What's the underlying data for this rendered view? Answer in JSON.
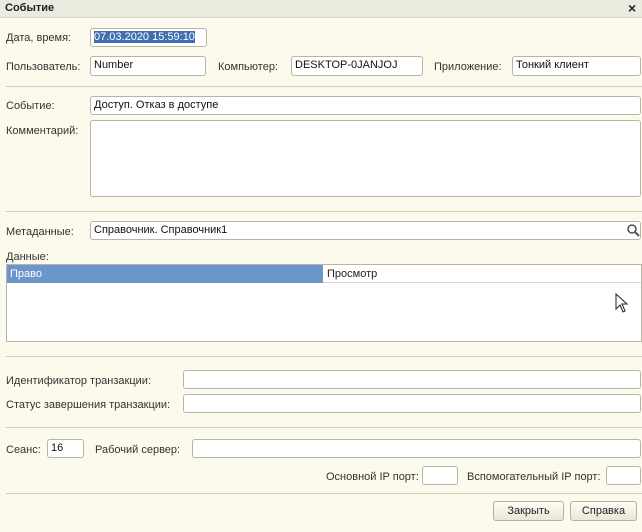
{
  "window": {
    "title": "Событие",
    "close_symbol": "×"
  },
  "fields": {
    "datetime": {
      "label": "Дата, время:",
      "value": "07.03.2020 15:59:10"
    },
    "user": {
      "label": "Пользователь:",
      "value": "Number"
    },
    "computer": {
      "label": "Компьютер:",
      "value": "DESKTOP-0JANJOJ"
    },
    "application": {
      "label": "Приложение:",
      "value": "Тонкий клиент"
    },
    "event": {
      "label": "Событие:",
      "value": "Доступ. Отказ в доступе"
    },
    "comment": {
      "label": "Комментарий:",
      "value": ""
    },
    "metadata": {
      "label": "Метаданные:",
      "value": "Справочник. Справочник1"
    },
    "data_label": "Данные:",
    "transaction_id": {
      "label": "Идентификатор транзакции:",
      "value": ""
    },
    "transaction_status": {
      "label": "Статус завершения транзакции:",
      "value": ""
    },
    "session": {
      "label": "Сеанс:",
      "value": "16"
    },
    "work_server": {
      "label": "Рабочий сервер:",
      "value": ""
    },
    "main_ip_port": {
      "label": "Основной IP порт:",
      "value": ""
    },
    "aux_ip_port": {
      "label": "Вспомогательный IP порт:",
      "value": ""
    }
  },
  "data_table": {
    "rows": [
      {
        "key": "Право",
        "value": "Просмотр"
      }
    ]
  },
  "buttons": {
    "close": "Закрыть",
    "help": "Справка"
  }
}
